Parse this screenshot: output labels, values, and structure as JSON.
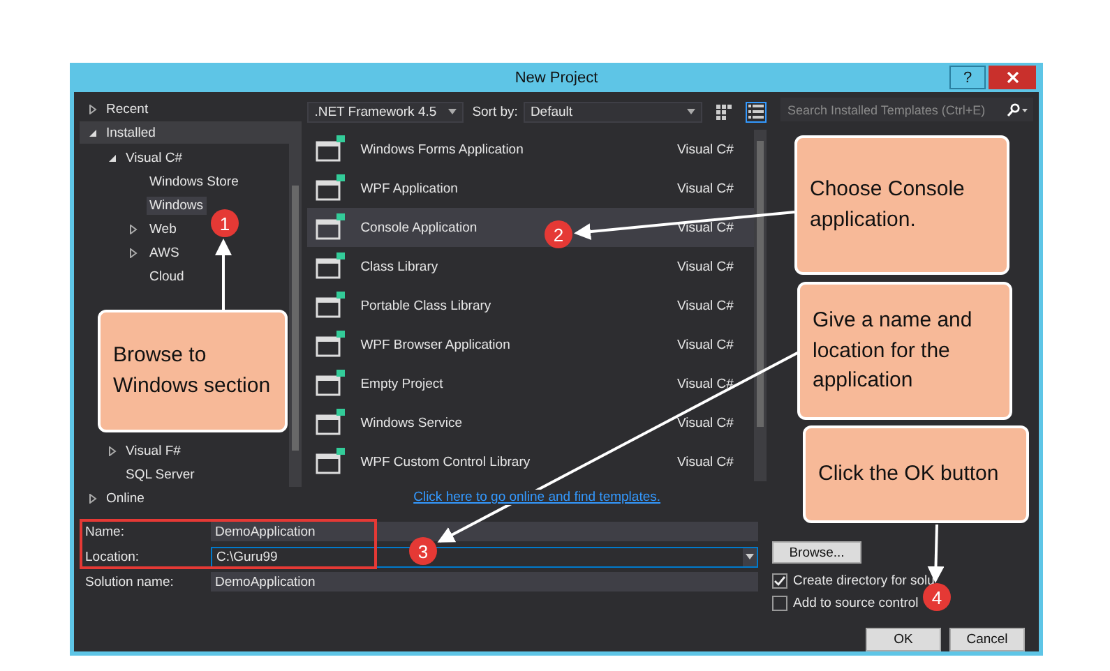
{
  "window": {
    "title": "New Project",
    "help": "?"
  },
  "tree": [
    {
      "label": "Recent",
      "expanded": false,
      "selected": false
    },
    {
      "label": "Installed",
      "expanded": true,
      "selected": true,
      "children": [
        {
          "label": "Visual C#",
          "expanded": true,
          "selected": false,
          "children": [
            {
              "label": "Windows Store",
              "selected": false
            },
            {
              "label": "Windows",
              "selected": true
            },
            {
              "label": "Web",
              "expanded": false,
              "selected": false
            },
            {
              "label": "AWS",
              "expanded": false,
              "selected": false
            },
            {
              "label": "Cloud",
              "selected": false
            }
          ]
        },
        {
          "label": "Visual F#",
          "expanded": false,
          "selected": false
        },
        {
          "label": "SQL Server",
          "selected": false
        }
      ]
    },
    {
      "label": "Online",
      "expanded": false,
      "selected": false
    }
  ],
  "toolbar": {
    "framework": ".NET Framework 4.5",
    "sort_label": "Sort by:",
    "sort": "Default",
    "views": [
      {
        "kind": "grid",
        "selected": false
      },
      {
        "kind": "list",
        "selected": true
      }
    ]
  },
  "search": {
    "placeholder": "Search Installed Templates (Ctrl+E)"
  },
  "templates": [
    {
      "name": "Windows Forms Application",
      "language": "Visual C#",
      "selected": false
    },
    {
      "name": "WPF Application",
      "language": "Visual C#",
      "selected": false
    },
    {
      "name": "Console Application",
      "language": "Visual C#",
      "selected": true
    },
    {
      "name": "Class Library",
      "language": "Visual C#",
      "selected": false
    },
    {
      "name": "Portable Class Library",
      "language": "Visual C#",
      "selected": false
    },
    {
      "name": "WPF Browser Application",
      "language": "Visual C#",
      "selected": false
    },
    {
      "name": "Empty Project",
      "language": "Visual C#",
      "selected": false
    },
    {
      "name": "Windows Service",
      "language": "Visual C#",
      "selected": false
    },
    {
      "name": "WPF Custom Control Library",
      "language": "Visual C#",
      "selected": false
    }
  ],
  "online_link": "Click here to go online and find templates.",
  "form": {
    "highlight_box": true,
    "fields": [
      {
        "label": "Name:",
        "value": "DemoApplication",
        "kind": "text"
      },
      {
        "label": "Location:",
        "value": "C:\\Guru99",
        "kind": "dropdown"
      },
      {
        "label": "Solution name:",
        "value": "DemoApplication",
        "kind": "text"
      }
    ]
  },
  "browse_button": "Browse...",
  "options": [
    {
      "label": "Create directory for solu",
      "checked": true
    },
    {
      "label": "Add to source control",
      "checked": false
    }
  ],
  "buttons": [
    "OK",
    "Cancel"
  ],
  "annotations": [
    {
      "text": "Browse to Windows section",
      "badge": "1"
    },
    {
      "text": "Choose Console application.",
      "badge": "2"
    },
    {
      "text": "Give a name and location for the application",
      "badge": "3"
    },
    {
      "text": "Click the OK button",
      "badge": "4"
    }
  ]
}
